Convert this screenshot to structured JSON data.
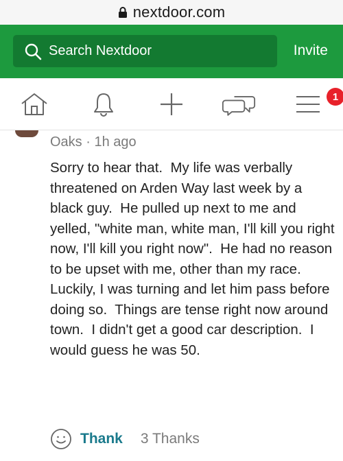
{
  "browser": {
    "url": "nextdoor.com"
  },
  "header": {
    "search_placeholder": "Search Nextdoor",
    "invite_label": "Invite",
    "colors": {
      "brand": "#1d9a3e",
      "search_bg": "#137a31"
    }
  },
  "nav": {
    "badge_count": "1",
    "items": [
      "home-icon",
      "bell-icon",
      "plus-icon",
      "messages-icon",
      "menu-icon"
    ]
  },
  "post": {
    "meta": "Oaks · 1h ago",
    "body": "Sorry to hear that.  My life was verbally threatened on Arden Way last week by a black guy.  He pulled up next to me and yelled, \"white man, white man, I'll kill you right now, I'll kill you right now\".  He had no reason to be upset with me, other than my race.  Luckily, I was turning and let him pass before doing so.  Things are tense right now around town.  I didn't get a good car description.  I would guess he was 50.",
    "thank_label": "Thank",
    "thanks_count": "3 Thanks"
  }
}
